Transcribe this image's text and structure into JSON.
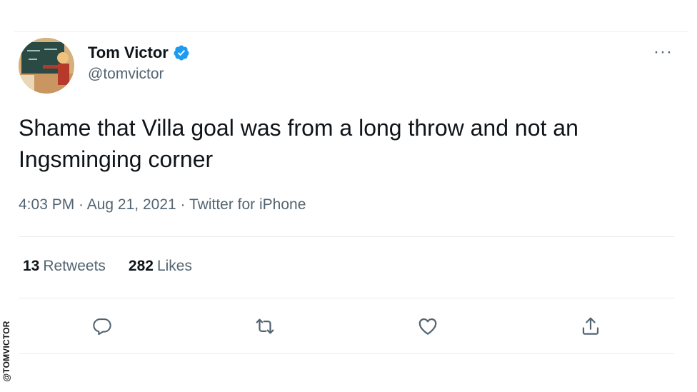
{
  "author": {
    "display_name": "Tom Victor",
    "handle": "@tomvictor",
    "verified": true,
    "avatar": "cartoon-teacher-at-chalkboard"
  },
  "menu": {
    "more_icon": "more-horizontal-icon",
    "more_label": "···"
  },
  "tweet": {
    "text": "Shame that Villa goal was from a long throw and not an Ingsminging corner"
  },
  "meta": {
    "time": "4:03 PM",
    "separator": " · ",
    "date": "Aug 21, 2021",
    "source": "Twitter for iPhone"
  },
  "stats": {
    "retweets_count": "13",
    "retweets_label": "Retweets",
    "likes_count": "282",
    "likes_label": "Likes"
  },
  "actions": [
    {
      "icon": "reply-icon"
    },
    {
      "icon": "retweet-icon"
    },
    {
      "icon": "like-heart-icon"
    },
    {
      "icon": "share-icon"
    }
  ],
  "watermark": {
    "text": "@TOMVICTOR"
  },
  "colors": {
    "text_primary": "#0f1419",
    "text_secondary": "#536471",
    "verified_blue": "#1d9bf0",
    "divider": "#e6ecf0"
  }
}
